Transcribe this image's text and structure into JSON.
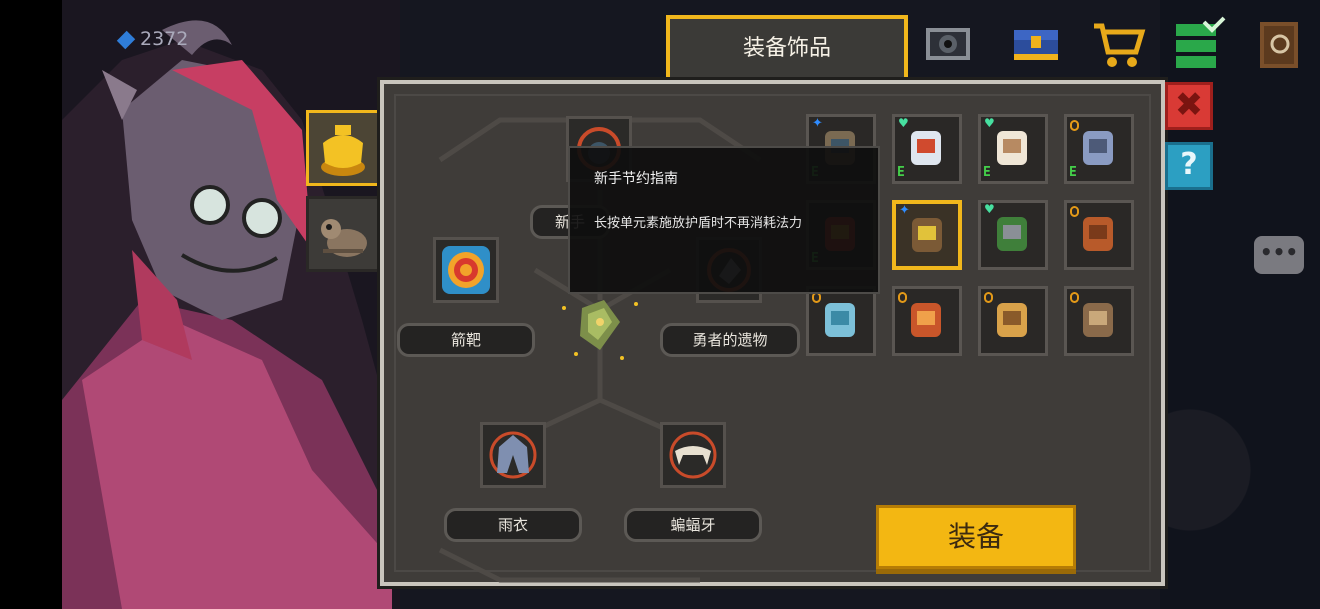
{
  "header": {
    "title": "装备饰品",
    "currency": "2372"
  },
  "equipped_slots": {
    "slot_top_label": "新手",
    "slot_left_label": "箭靶",
    "slot_right_label": "勇者的遗物",
    "slot_bottom_left_label": "雨衣",
    "slot_bottom_right_label": "蝙蝠牙"
  },
  "tooltip": {
    "title": "新手节约指南",
    "description": "长按单元素施放护盾时不再消耗法力"
  },
  "inventory": {
    "badge_letter": "E",
    "items": [
      {
        "name": "skull-ring-icon",
        "badge": "E",
        "mark": "star"
      },
      {
        "name": "fang-wing-icon",
        "badge": "E",
        "mark": "heart"
      },
      {
        "name": "bat-tooth-icon",
        "badge": "E",
        "mark": "heart"
      },
      {
        "name": "raincoat-icon",
        "badge": "E",
        "mark": "coin"
      },
      {
        "name": "target-icon",
        "badge": "E",
        "mark": "none"
      },
      {
        "name": "map-scroll-icon",
        "badge": "",
        "mark": "star"
      },
      {
        "name": "green-pipe-icon",
        "badge": "",
        "mark": "heart"
      },
      {
        "name": "boot-icon",
        "badge": "",
        "mark": "coin"
      },
      {
        "name": "sock-icon",
        "badge": "",
        "mark": "coin"
      },
      {
        "name": "bead-chain-icon",
        "badge": "",
        "mark": "coin"
      },
      {
        "name": "cape-icon",
        "badge": "",
        "mark": "coin"
      },
      {
        "name": "pickaxe-icon",
        "badge": "",
        "mark": "coin"
      }
    ]
  },
  "buttons": {
    "equip": "装备",
    "close": "✖",
    "help": "?",
    "chat": "•••"
  },
  "colors": {
    "accent": "#f1b71c",
    "panel": "#3f3c39",
    "close": "#d93a35",
    "help": "#2c9fc2",
    "badge_e": "#44d04a"
  }
}
